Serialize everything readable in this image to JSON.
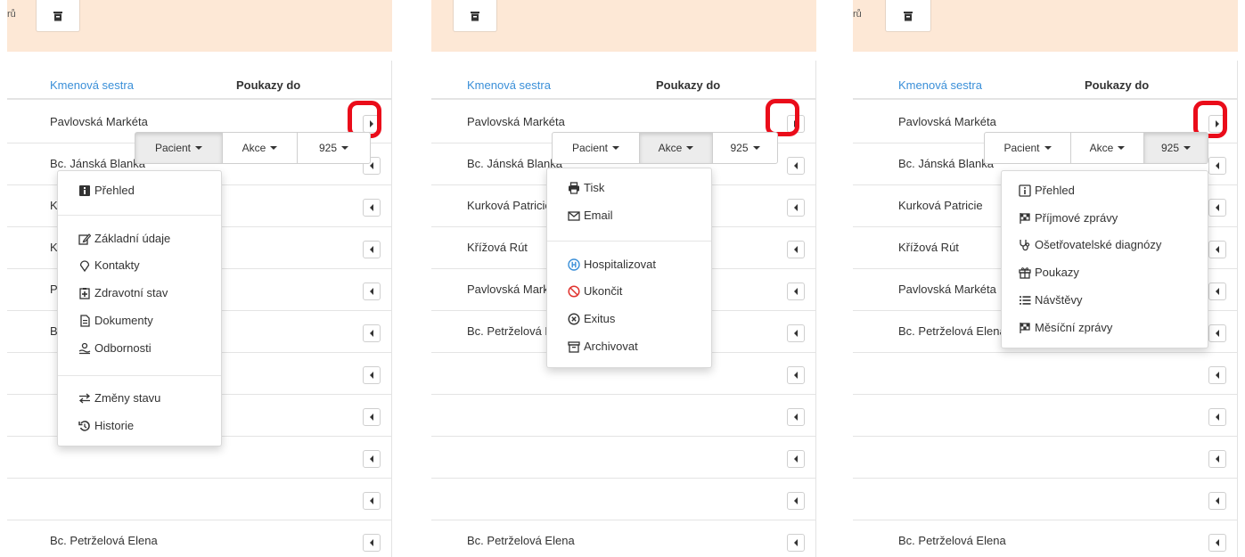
{
  "toolbar": {
    "truncated_text_1": "rů",
    "truncated_text_3": "rů"
  },
  "table": {
    "col_nurse": "Kmenová sestra",
    "col_vouchers": "Poukazy do",
    "rows": [
      "Pavlovská Markéta",
      "Bc. Jánská Blanka",
      "Kurková Patricie",
      "Křížová Rút",
      "Pavlovská Markéta",
      "Bc. Petrželová Elena",
      "",
      "",
      "",
      "",
      "Bc. Petrželová Elena"
    ]
  },
  "button_group": {
    "patient": "Pacient",
    "actions": "Akce",
    "code": "925"
  },
  "menu_patient": {
    "items": [
      "Přehled",
      "Základní údaje",
      "Kontakty",
      "Zdravotní stav",
      "Dokumenty",
      "Odbornosti",
      "Změny stavu",
      "Historie"
    ],
    "icons": [
      "info-icon",
      "edit-icon",
      "map-pin-icon",
      "clipboard-plus-icon",
      "document-icon",
      "hand-icon",
      "swap-icon",
      "history-icon"
    ]
  },
  "menu_actions": {
    "items": [
      "Tisk",
      "Email",
      "Hospitalizovat",
      "Ukončit",
      "Exitus",
      "Archivovat"
    ],
    "icons": [
      "printer-icon",
      "envelope-icon",
      "hospital-icon",
      "ban-icon",
      "x-circle-icon",
      "archive-icon"
    ]
  },
  "menu_code": {
    "items": [
      "Přehled",
      "Příjmové zprávy",
      "Ošetřovatelské diagnózy",
      "Poukazy",
      "Návštěvy",
      "Měsíční zprávy"
    ],
    "icons": [
      "info-icon",
      "flag-icon",
      "stethoscope-icon",
      "gift-icon",
      "list-icon",
      "flag-icon"
    ]
  },
  "colors": {
    "link": "#3a8fd8",
    "toolbar_band": "#fde8d6",
    "highlight": "#ea0c1a",
    "hospital_icon": "#3a8fd8",
    "ban_icon": "#e0332e"
  }
}
